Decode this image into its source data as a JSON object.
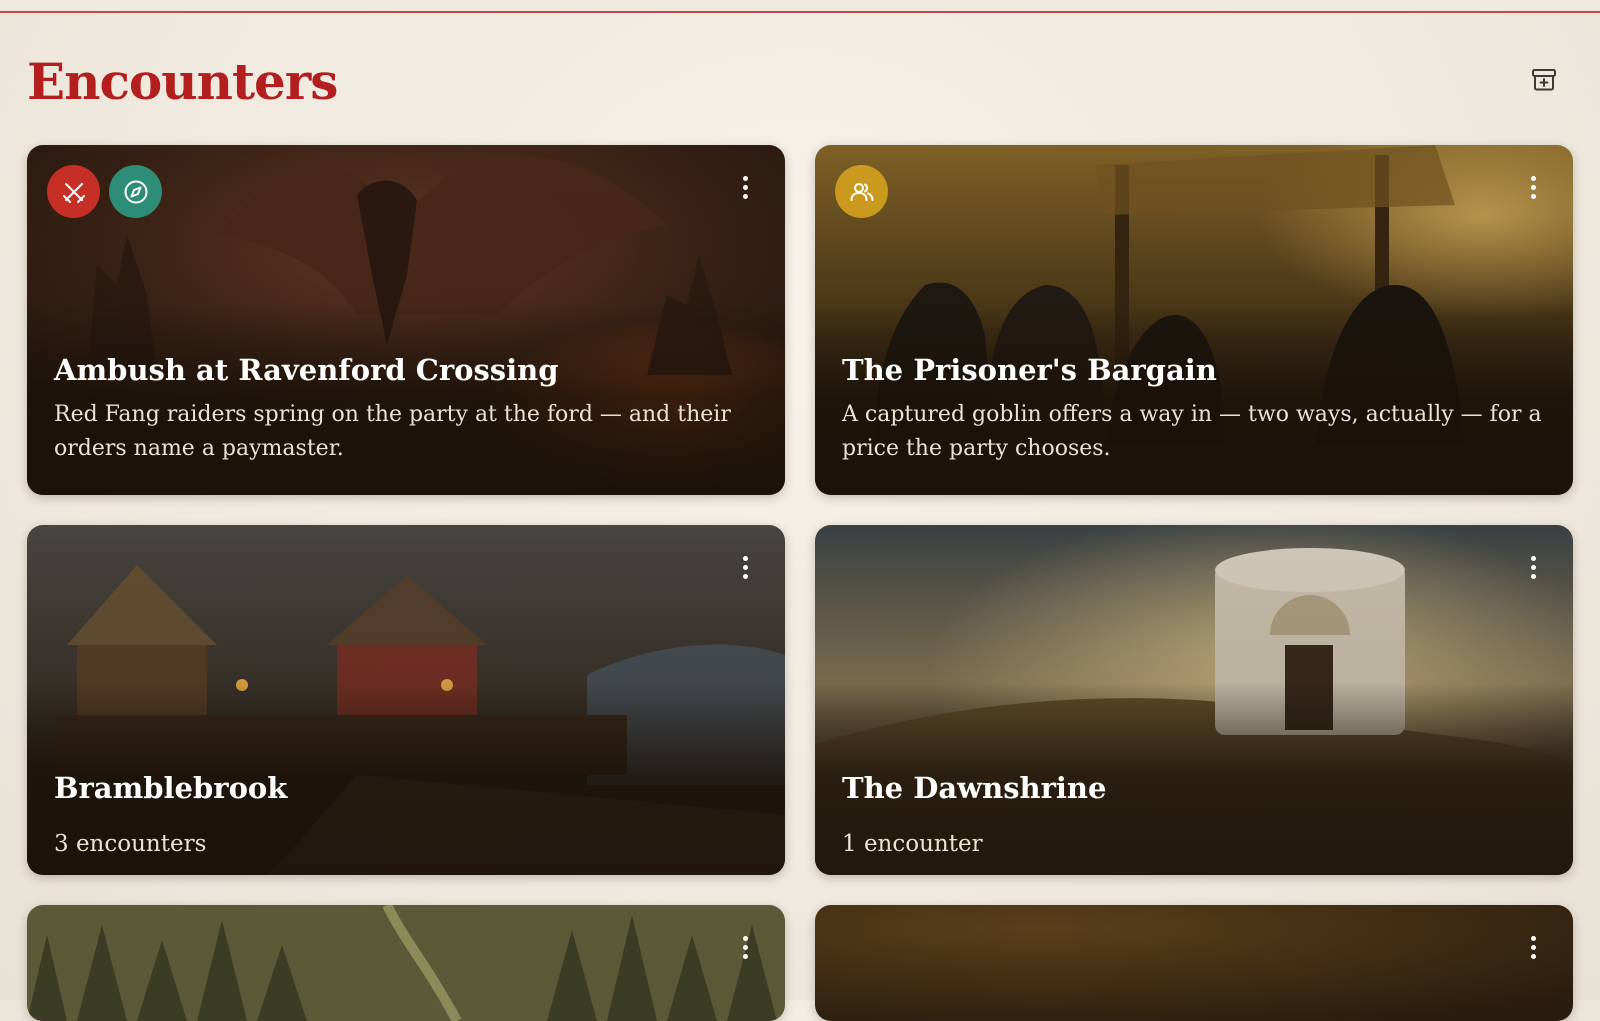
{
  "page": {
    "title": "Encounters"
  },
  "header": {
    "action_icon": "archive-plus-icon"
  },
  "colors": {
    "accent": "#b31f1f",
    "combat": "#c62f26",
    "exploration": "#2e8d76",
    "social": "#c99a1e"
  },
  "cards": [
    {
      "title": "Ambush at Ravenford Crossing",
      "description": "Red Fang raiders spring on the party at the ford — and their orders name a paymaster.",
      "badges": [
        "crossed-swords-icon",
        "compass-icon"
      ]
    },
    {
      "title": "The Prisoner's Bargain",
      "description": "A captured goblin offers a way in — two ways, actually — for a price the party chooses.",
      "badges": [
        "people-icon"
      ]
    },
    {
      "title": "Bramblebrook",
      "subtitle": "3 encounters"
    },
    {
      "title": "The Dawnshrine",
      "subtitle": "1 encounter"
    },
    {
      "title": ""
    },
    {
      "title": ""
    }
  ]
}
